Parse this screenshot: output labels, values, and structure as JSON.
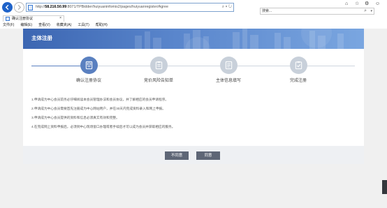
{
  "browser": {
    "url_prefix": "http://",
    "url_host": "58.216.50.99",
    "url_rest": ":8071/TPBidder/huiyuaninfomis2/pages/huiyuanregister/Agree",
    "address_tools": "⌕ ▾ ↻",
    "search_placeholder": "搜索...",
    "search_icon": "⌕",
    "search_dropdown": "▾",
    "tab_title": "确认注册协议",
    "tab_close": "×",
    "window_controls": [
      "⌂",
      "☆",
      "⚙",
      "☺"
    ],
    "menu": [
      "文件(F)",
      "编辑(E)",
      "查看(V)",
      "收藏夹(A)",
      "工具(T)",
      "帮助(H)"
    ]
  },
  "page": {
    "banner_title": "主体注册",
    "steps": [
      {
        "label": "确认注册协议",
        "state": "active",
        "icon": "document-icon"
      },
      {
        "label": "竞价风险告知单",
        "state": "inactive",
        "icon": "clipboard-icon"
      },
      {
        "label": "主体信息填写",
        "state": "inactive",
        "icon": "form-list-icon"
      },
      {
        "label": "完成注册",
        "state": "inactive",
        "icon": "check-clipboard-icon"
      }
    ],
    "terms": [
      "1.申请成为中心会员前务必仔细阅读本会员管理办法和会员协议，并了解相应的会员申请程序。",
      "2.申请成为中心会员需要首先注册成为中心网站用户，并在30天内完成资料录入和网上申报。",
      "3.申请成为中心会员提供的资料和信息必须真实有效和完整。",
      "4.在完成网上资料申报后，必须到中心现场窗口办理或者手续后才可以成为会员并获取相应的服务。"
    ],
    "buttons": {
      "disagree": "不同意",
      "agree": "同意"
    }
  },
  "colors": {
    "active": "#5a80c0",
    "inactive": "#c8d0da",
    "button": "#5e6676",
    "banner": "#4a75bf"
  }
}
